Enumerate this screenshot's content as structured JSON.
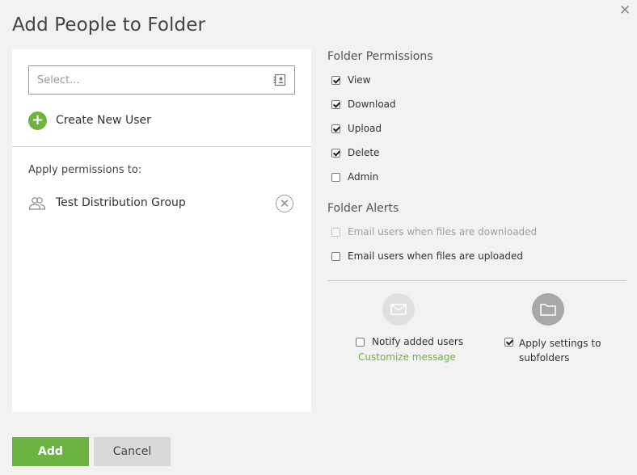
{
  "dialog": {
    "title": "Add People to Folder"
  },
  "recipients": {
    "search_placeholder": "Select...",
    "create_user_label": "Create New User",
    "apply_permissions_label": "Apply permissions to:",
    "groups": [
      {
        "name": "Test Distribution Group"
      }
    ]
  },
  "permissions": {
    "title": "Folder Permissions",
    "items": [
      {
        "label": "View",
        "checked": true
      },
      {
        "label": "Download",
        "checked": true
      },
      {
        "label": "Upload",
        "checked": true
      },
      {
        "label": "Delete",
        "checked": true
      },
      {
        "label": "Admin",
        "checked": false
      }
    ]
  },
  "alerts": {
    "title": "Folder Alerts",
    "items": [
      {
        "label": "Email users when files are downloaded",
        "checked": false,
        "disabled": true
      },
      {
        "label": "Email users when files are uploaded",
        "checked": false,
        "disabled": false
      }
    ]
  },
  "options": {
    "notify_label": "Notify added users",
    "notify_checked": false,
    "customize_link": "Customize message",
    "subfolders_label": "Apply settings to subfolders",
    "subfolders_checked": true
  },
  "footer": {
    "add_label": "Add",
    "cancel_label": "Cancel"
  },
  "colors": {
    "accent": "#6db33f",
    "background": "#f2f2f2"
  },
  "icons": {
    "close": "close-icon",
    "contacts": "address-book-icon",
    "add": "plus-icon",
    "group": "group-icon",
    "remove": "remove-icon",
    "mail": "mail-icon",
    "folder": "folder-icon"
  }
}
